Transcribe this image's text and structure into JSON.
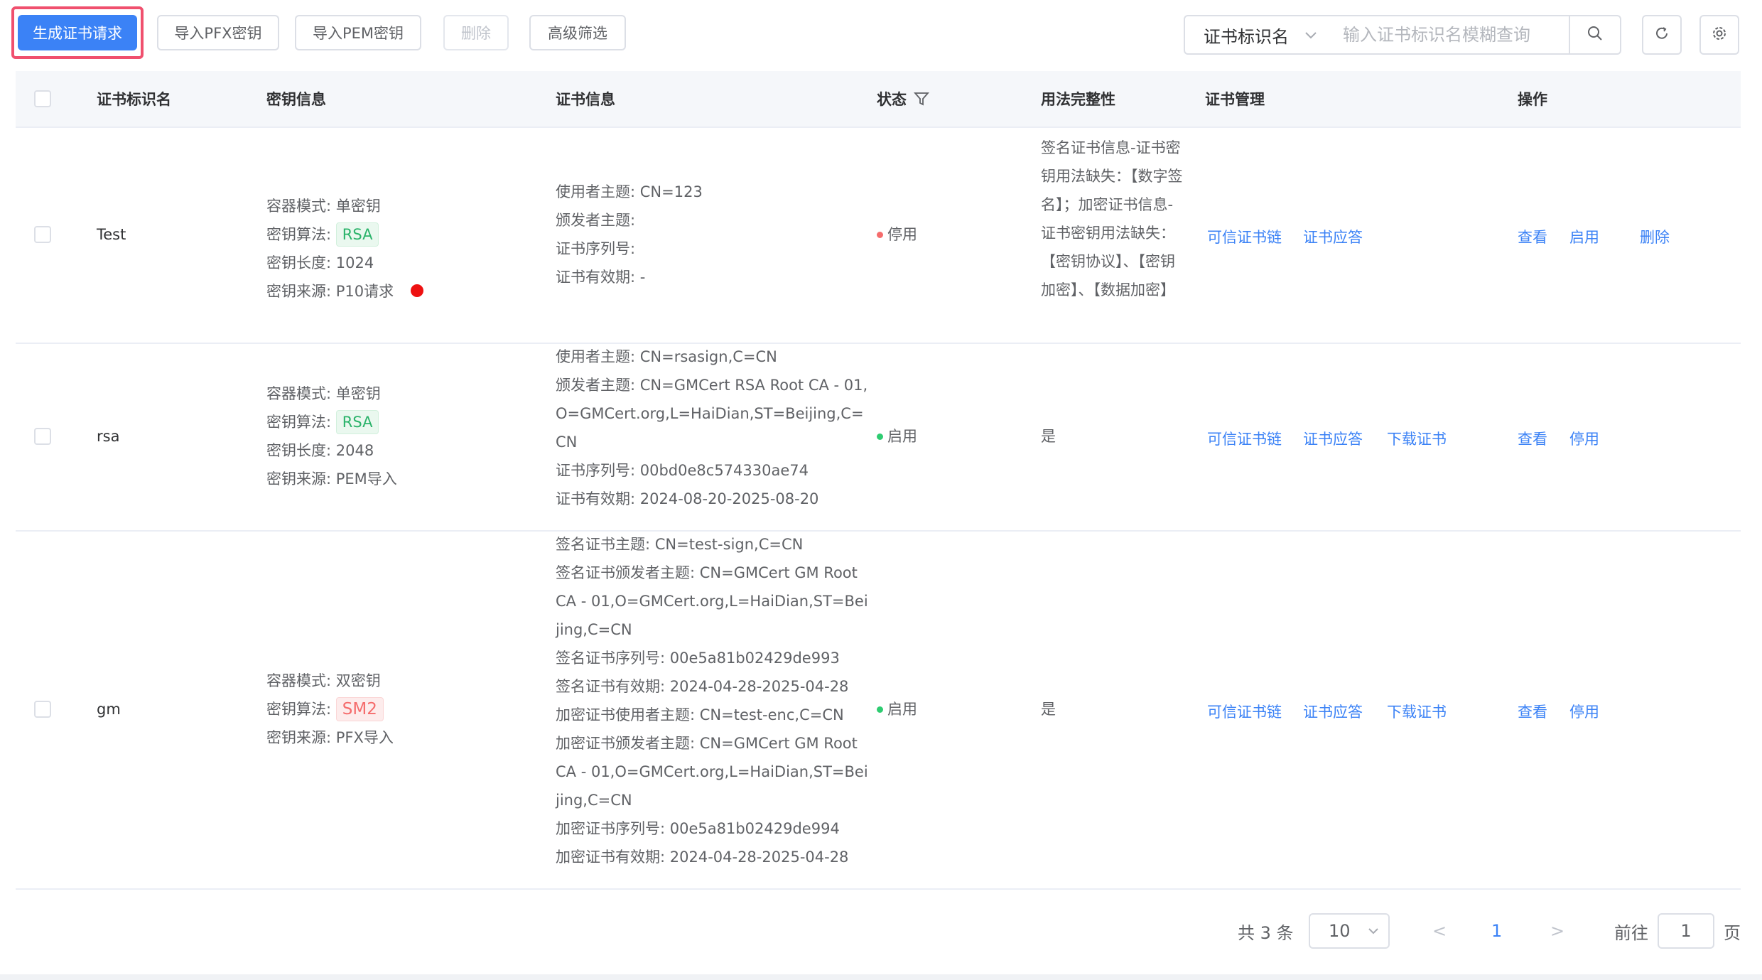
{
  "toolbar": {
    "generate_label": "生成证书请求",
    "import_pfx_label": "导入PFX密钥",
    "import_pem_label": "导入PEM密钥",
    "delete_label": "删除",
    "advanced_filter_label": "高级筛选",
    "search_field": "证书标识名",
    "search_placeholder": "输入证书标识名模糊查询"
  },
  "columns": {
    "name": "证书标识名",
    "key_info": "密钥信息",
    "cert_info": "证书信息",
    "status": "状态",
    "usage": "用法完整性",
    "cert_mgmt": "证书管理",
    "actions": "操作"
  },
  "rows": [
    {
      "name": "Test",
      "key": {
        "mode": "容器模式: 单密钥",
        "algo_label": "密钥算法: ",
        "algo": "RSA",
        "length": "密钥长度: 1024",
        "source": "密钥来源: P10请求"
      },
      "cert": {
        "subject": "使用者主题: CN=123",
        "issuer": "颁发者主题:",
        "serial": "证书序列号:",
        "validity": "证书有效期: -"
      },
      "status": "停用",
      "usage": "签名证书信息-证书密钥用法缺失：【数字签名】；加密证书信息-证书密钥用法缺失：【密钥协议】、【密钥加密】、【数据加密】",
      "mgmt": {
        "chain": "可信证书链",
        "reply": "证书应答"
      },
      "actions": {
        "view": "查看",
        "toggle": "启用",
        "delete": "删除"
      }
    },
    {
      "name": "rsa",
      "key": {
        "mode": "容器模式: 单密钥",
        "algo_label": "密钥算法: ",
        "algo": "RSA",
        "length": "密钥长度: 2048",
        "source": "密钥来源: PEM导入"
      },
      "cert": {
        "subject": "使用者主题: CN=rsasign,C=CN",
        "issuer": "颁发者主题: CN=GMCert RSA Root CA - 01,O=GMCert.org,L=HaiDian,ST=Beijing,C=CN",
        "serial": "证书序列号: 00bd0e8c574330ae74",
        "validity": "证书有效期: 2024-08-20-2025-08-20"
      },
      "status": "启用",
      "usage": "是",
      "mgmt": {
        "chain": "可信证书链",
        "reply": "证书应答",
        "download": "下载证书"
      },
      "actions": {
        "view": "查看",
        "toggle": "停用"
      }
    },
    {
      "name": "gm",
      "key": {
        "mode": "容器模式: 双密钥",
        "algo_label": "密钥算法: ",
        "algo": "SM2",
        "source": "密钥来源: PFX导入"
      },
      "cert": {
        "sign_subject": "签名证书主题: CN=test-sign,C=CN",
        "sign_issuer": "签名证书颁发者主题: CN=GMCert GM Root CA - 01,O=GMCert.org,L=HaiDian,ST=Beijing,C=CN",
        "sign_serial": "签名证书序列号: 00e5a81b02429de993",
        "sign_validity": "签名证书有效期: 2024-04-28-2025-04-28",
        "enc_subject": "加密证书使用者主题: CN=test-enc,C=CN",
        "enc_issuer": "加密证书颁发者主题: CN=GMCert GM Root CA - 01,O=GMCert.org,L=HaiDian,ST=Beijing,C=CN",
        "enc_serial": "加密证书序列号: 00e5a81b02429de994",
        "enc_validity": "加密证书有效期: 2024-04-28-2025-04-28"
      },
      "status": "启用",
      "usage": "是",
      "mgmt": {
        "chain": "可信证书链",
        "reply": "证书应答",
        "download": "下载证书"
      },
      "actions": {
        "view": "查看",
        "toggle": "停用"
      }
    }
  ],
  "pagination": {
    "total": "共 3 条",
    "page_size": "10",
    "prev": "<",
    "current": "1",
    "next": ">",
    "goto_label": "前往",
    "goto_value": "1",
    "page_suffix": "页"
  },
  "colors": {
    "primary": "#3b82f6",
    "highlight": "#f0506e",
    "enabled": "#2ecc71",
    "disabled": "#f56c6c"
  }
}
